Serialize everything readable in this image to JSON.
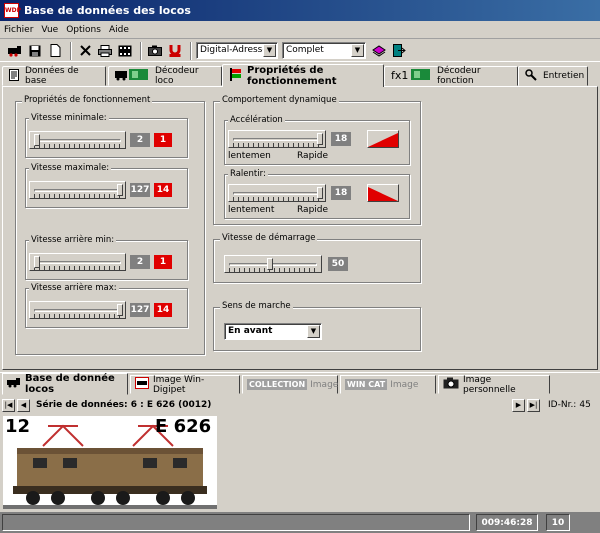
{
  "window": {
    "title": "Base de données des locos",
    "app_icon": "WDP"
  },
  "menu": [
    "Fichier",
    "Vue",
    "Options",
    "Aide"
  ],
  "toolbar": {
    "address_mode": "Digital-Adresse",
    "list_mode": "Complet",
    "buttons": [
      "locomotive-icon",
      "save-icon",
      "new-icon",
      "delete-icon",
      "print-icon",
      "film-icon",
      "camera-icon",
      "magnet-icon",
      "books-icon",
      "exit-icon"
    ]
  },
  "tabs": [
    {
      "label": "Données de base",
      "icon": "document-icon"
    },
    {
      "label": "Décodeur loco",
      "icon": "loco-decoder-icon"
    },
    {
      "label": "Propriétés de fonctionnement",
      "icon": "signal-icon",
      "active": true
    },
    {
      "label": "Décodeur fonction",
      "icon": "fx1-decoder-icon"
    },
    {
      "label": "Entretien",
      "icon": "wrench-icon"
    }
  ],
  "props": {
    "group_label": "Propriétés de fonctionnement",
    "vmin": {
      "label": "Vitesse minimale:",
      "value": "2",
      "step": "1",
      "level": 0.02
    },
    "vmax": {
      "label": "Vitesse maximale:",
      "value": "127",
      "step": "14",
      "level": 1.0
    },
    "vrmin": {
      "label": "Vitesse arrière min:",
      "value": "2",
      "step": "1",
      "level": 0.02
    },
    "vrmax": {
      "label": "Vitesse arrière max:",
      "value": "127",
      "step": "14",
      "level": 1.0
    }
  },
  "dyn": {
    "group_label": "Comportement dynamique",
    "accel": {
      "label": "Accélération",
      "value": "18",
      "left": "lentemen",
      "right": "Rapide",
      "level": 1.0
    },
    "brake": {
      "label": "Ralentir:",
      "value": "18",
      "left": "lentement",
      "right": "Rapide",
      "level": 1.0
    }
  },
  "start": {
    "label": "Vitesse de démarrage",
    "value": "50",
    "level": 0.47
  },
  "direction": {
    "label": "Sens de marche",
    "value": "En avant"
  },
  "bottom_tabs": [
    {
      "label": "Base de donnée locos",
      "active": true
    },
    {
      "label": "Image Win-Digipet"
    },
    {
      "label": "Image",
      "logo": "COLLECTION",
      "disabled": true
    },
    {
      "label": "Image",
      "logo": "WIN CAT",
      "disabled": true
    },
    {
      "label": "Image personnelle"
    }
  ],
  "record": {
    "series": "Série de données: 6 : E 626  (0012)",
    "id_label": "ID-Nr.:",
    "id_value": "45"
  },
  "image": {
    "left_number": "12",
    "right_text": "E 626"
  },
  "status": {
    "time": "009:46:28",
    "count": "10"
  },
  "colors": {
    "accent_red": "#e00000",
    "value_grey": "#808080",
    "title_blue": "#0a246a"
  }
}
